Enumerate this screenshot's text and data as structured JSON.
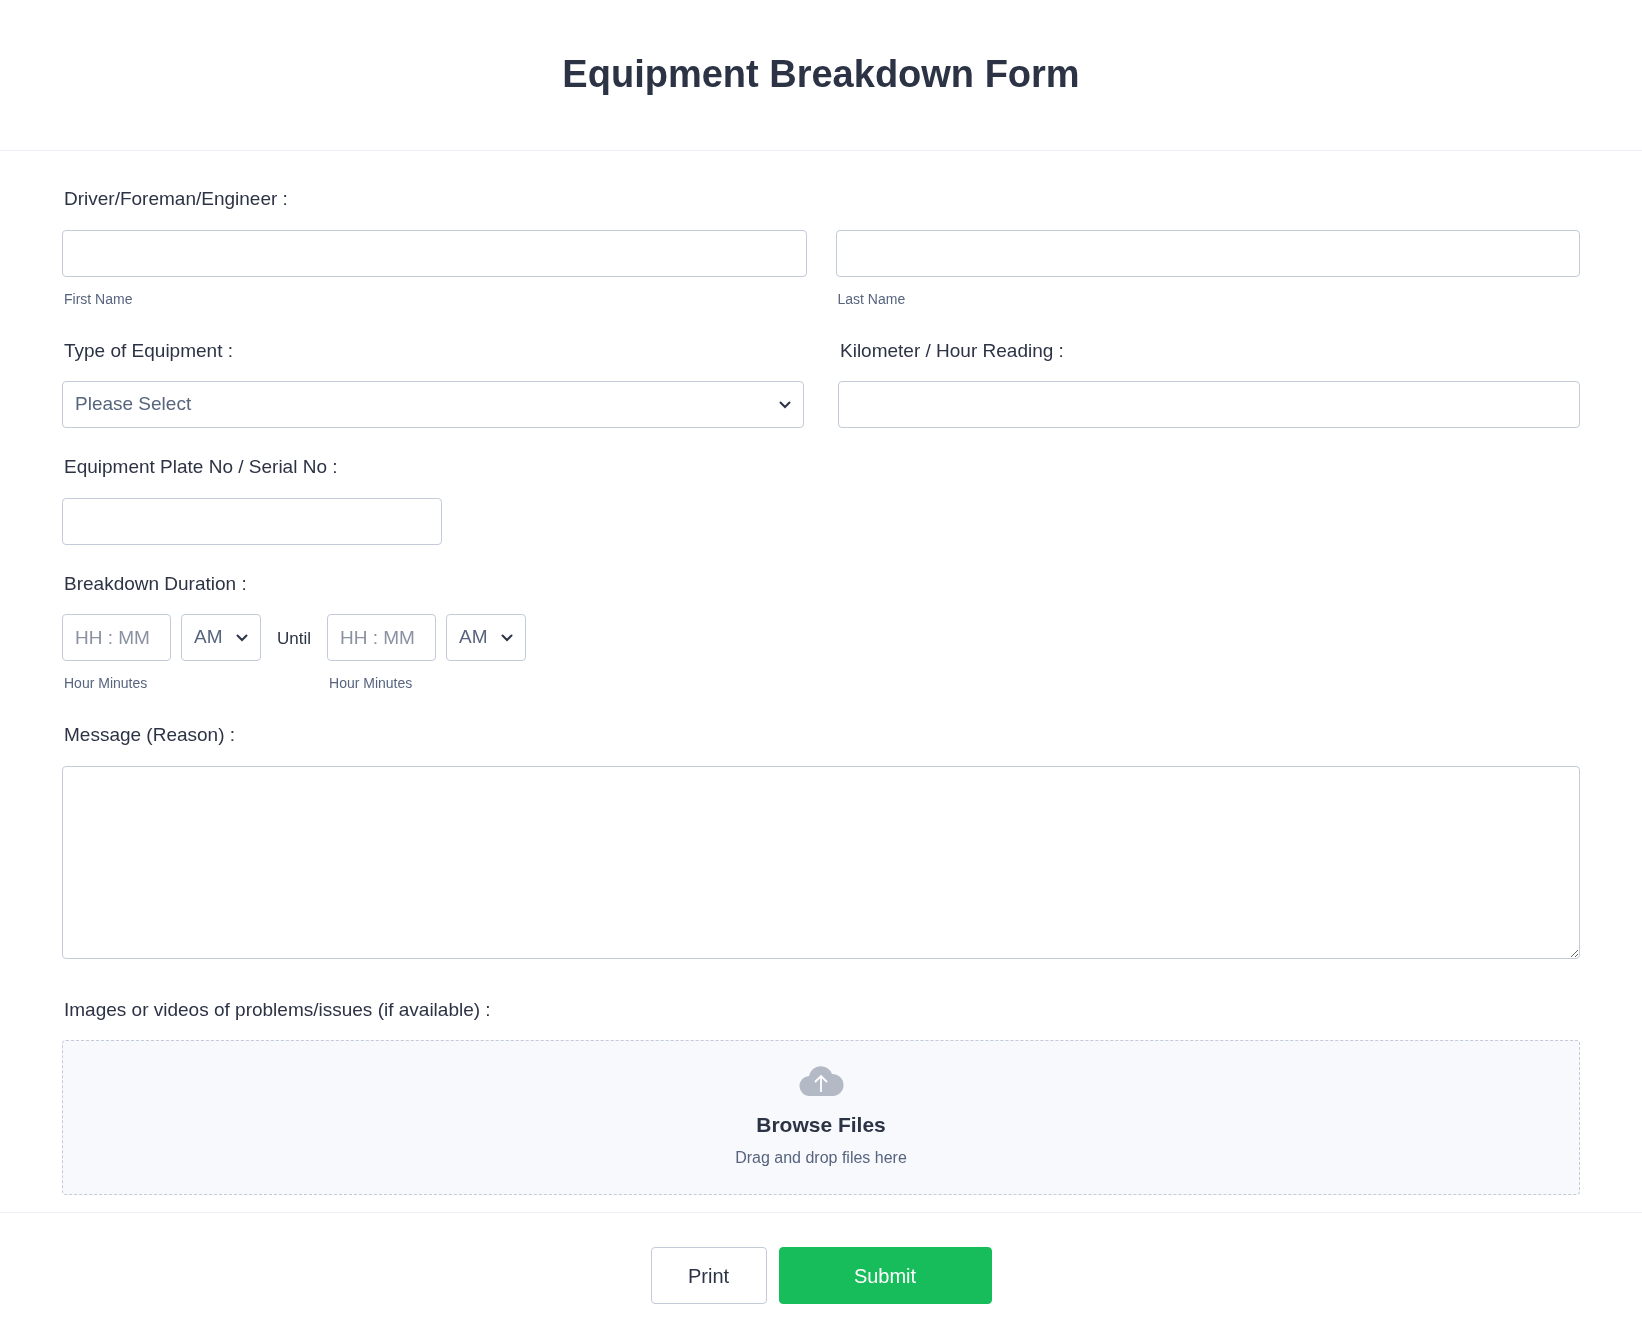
{
  "title": "Equipment Breakdown Form",
  "driver": {
    "label": "Driver/Foreman/Engineer :",
    "first_sublabel": "First Name",
    "last_sublabel": "Last Name"
  },
  "equipment_type": {
    "label": "Type of Equipment :",
    "placeholder": "Please Select"
  },
  "reading": {
    "label": "Kilometer / Hour Reading :"
  },
  "plate": {
    "label": "Equipment Plate No / Serial No :"
  },
  "duration": {
    "label": "Breakdown Duration :",
    "separator": "Until",
    "times": [
      {
        "placeholder": "HH : MM",
        "ampm": "AM",
        "sublabel": "Hour Minutes"
      },
      {
        "placeholder": "HH : MM",
        "ampm": "AM",
        "sublabel": "Hour Minutes"
      }
    ]
  },
  "message": {
    "label": "Message (Reason) :"
  },
  "upload": {
    "label": "Images or videos of problems/issues (if available) :",
    "title": "Browse Files",
    "hint": "Drag and drop files here"
  },
  "buttons": [
    {
      "kind": "secondary",
      "label": "Print"
    },
    {
      "kind": "primary",
      "label": "Submit"
    }
  ]
}
